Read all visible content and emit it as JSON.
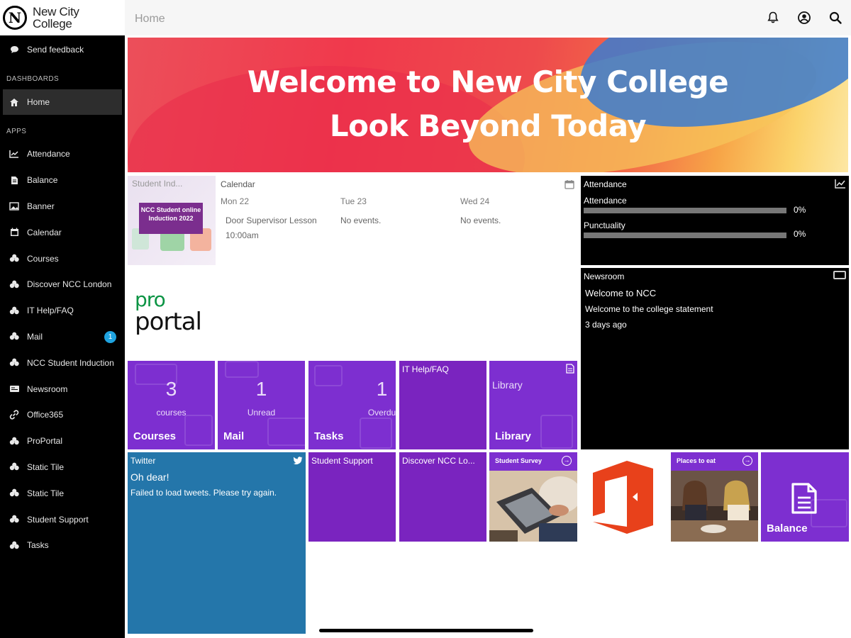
{
  "brand": {
    "logo_letter": "N",
    "line1": "New City",
    "line2": "College"
  },
  "sidebar": {
    "feedback": "Send feedback",
    "dashboards_label": "DASHBOARDS",
    "home": "Home",
    "apps_label": "APPS",
    "items": [
      {
        "label": "Attendance",
        "icon": "chart-icon"
      },
      {
        "label": "Balance",
        "icon": "document-icon"
      },
      {
        "label": "Banner",
        "icon": "image-icon"
      },
      {
        "label": "Calendar",
        "icon": "calendar-icon"
      },
      {
        "label": "Courses",
        "icon": "app-icon"
      },
      {
        "label": "Discover NCC London",
        "icon": "app-icon"
      },
      {
        "label": "IT Help/FAQ",
        "icon": "app-icon"
      },
      {
        "label": "Mail",
        "icon": "app-icon",
        "badge": "1"
      },
      {
        "label": "NCC Student Induction",
        "icon": "app-icon"
      },
      {
        "label": "Newsroom",
        "icon": "news-icon"
      },
      {
        "label": "Office365",
        "icon": "link-icon"
      },
      {
        "label": "ProPortal",
        "icon": "app-icon"
      },
      {
        "label": "Static Tile",
        "icon": "app-icon"
      },
      {
        "label": "Static Tile",
        "icon": "app-icon"
      },
      {
        "label": "Student Support",
        "icon": "app-icon"
      },
      {
        "label": "Tasks",
        "icon": "app-icon"
      }
    ]
  },
  "topbar": {
    "title": "Home"
  },
  "banner": {
    "line1": "Welcome to New City College",
    "line2": "Look Beyond Today"
  },
  "calendar_thumb": {
    "title": "Student Ind...",
    "tag": "NCC Student online Induction 2022"
  },
  "calendar": {
    "label": "Calendar",
    "days": [
      {
        "day": "Mon 22",
        "event": "Door Supervisor Lesson",
        "time": "10:00am"
      },
      {
        "day": "Tue 23",
        "event": "No events."
      },
      {
        "day": "Wed 24",
        "event": "No events."
      }
    ]
  },
  "proportal": {
    "pro": "pro",
    "portal": "portal"
  },
  "attendance": {
    "title": "Attendance",
    "rows": [
      {
        "label": "Attendance",
        "value": "0%",
        "fraction": 0
      },
      {
        "label": "Punctuality",
        "value": "0%",
        "fraction": 0
      }
    ]
  },
  "newsroom": {
    "title": "Newsroom",
    "headline": "Welcome to NCC",
    "summary": "Welcome to the college statement",
    "age": "3 days ago"
  },
  "tiles": {
    "courses": {
      "num": "3",
      "sub": "courses",
      "name": "Courses"
    },
    "mail": {
      "num": "1",
      "sub": "Unread",
      "name": "Mail"
    },
    "tasks": {
      "num": "1",
      "sub": "Overdu",
      "name": "Tasks"
    },
    "ithelp": {
      "title": "IT Help/FAQ"
    },
    "library": {
      "top": "Library",
      "name": "Library"
    },
    "student_support": {
      "title": "Student Support"
    },
    "discover": {
      "title": "Discover NCC Lo..."
    },
    "survey": {
      "title": "Student Survey"
    },
    "places": {
      "title": "Places to eat"
    },
    "balance": {
      "name": "Balance"
    }
  },
  "twitter": {
    "title": "Twitter",
    "heading": "Oh dear!",
    "message": "Failed to load tweets. Please try again."
  },
  "colors": {
    "purple": "#7d2fd0",
    "twitter_blue": "#2476aa",
    "office_orange": "#e8411b"
  }
}
